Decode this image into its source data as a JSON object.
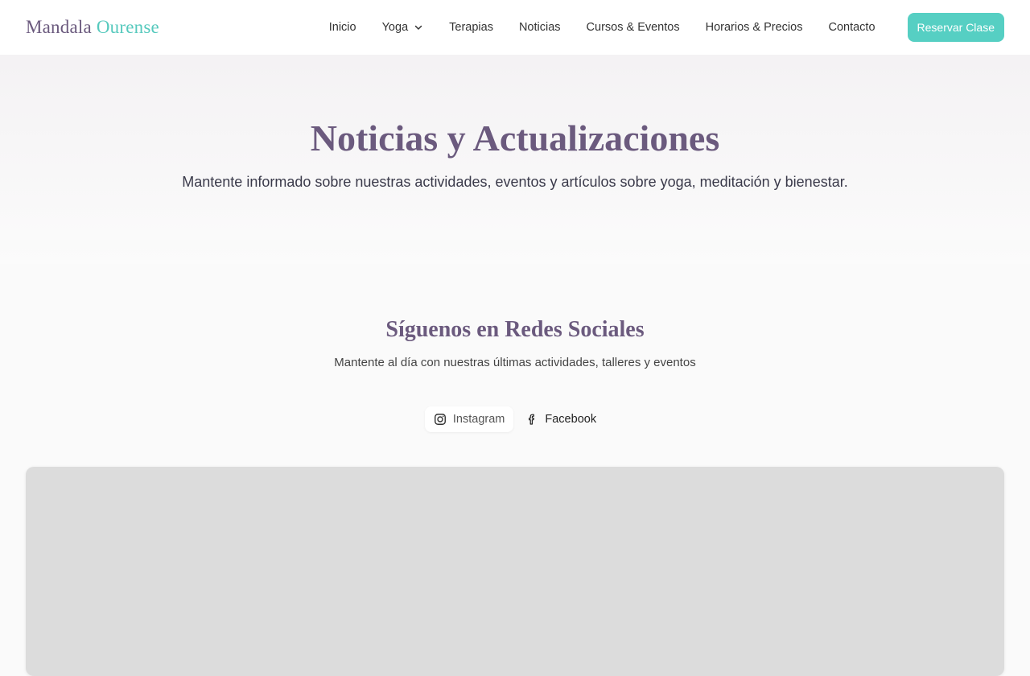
{
  "header": {
    "logo_primary": "Mandala",
    "logo_accent": "Ourense",
    "nav": [
      {
        "label": "Inicio"
      },
      {
        "label": "Yoga",
        "has_dropdown": true
      },
      {
        "label": "Terapias"
      },
      {
        "label": "Noticias"
      },
      {
        "label": "Cursos & Eventos"
      },
      {
        "label": "Horarios & Precios"
      },
      {
        "label": "Contacto"
      }
    ],
    "cta_label": "Reservar Clase"
  },
  "hero": {
    "title": "Noticias y Actualizaciones",
    "subtitle": "Mantente informado sobre nuestras actividades, eventos y artículos sobre yoga, meditación y bienestar."
  },
  "social": {
    "title": "Síguenos en Redes Sociales",
    "subtitle": "Mantente al día con nuestras últimas actividades, talleres y eventos",
    "tabs": [
      {
        "label": "Instagram",
        "icon": "instagram-icon",
        "active": true
      },
      {
        "label": "Facebook",
        "icon": "facebook-icon",
        "active": false
      }
    ]
  },
  "colors": {
    "brand": "#6b5a7e",
    "accent": "#56cfc3",
    "feed_placeholder": "#dcdcdc"
  }
}
